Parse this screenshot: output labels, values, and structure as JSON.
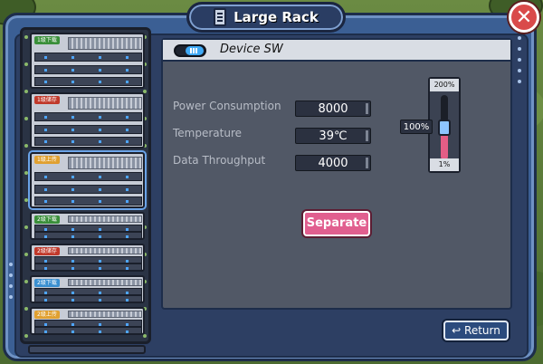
{
  "window": {
    "title": "Large Rack",
    "close_label": "✕"
  },
  "rack": {
    "units": [
      {
        "tag": "1级下载",
        "tag_color": "#3a8f3a",
        "size": "big",
        "selected": false
      },
      {
        "tag": "1级储存",
        "tag_color": "#c0392b",
        "size": "big",
        "selected": false
      },
      {
        "tag": "1级上传",
        "tag_color": "#e0a030",
        "size": "big",
        "selected": true
      },
      {
        "tag": "2级下载",
        "tag_color": "#3a8f3a",
        "size": "small",
        "selected": false
      },
      {
        "tag": "2级储存",
        "tag_color": "#c0392b",
        "size": "small",
        "selected": false
      },
      {
        "tag": "2级下载",
        "tag_color": "#3a8fd0",
        "size": "small",
        "selected": false
      },
      {
        "tag": "2级上传",
        "tag_color": "#e0a030",
        "size": "small",
        "selected": false
      }
    ]
  },
  "device": {
    "name": "Device SW",
    "stats": [
      {
        "label": "Power Consumption",
        "value": "8000"
      },
      {
        "label": "Temperature",
        "value": "39℃"
      },
      {
        "label": "Data Throughput",
        "value": "4000"
      }
    ],
    "gauge": {
      "max_label": "200%",
      "min_label": "1%",
      "current_label": "100%",
      "level": 0.5
    },
    "separate_label": "Separate"
  },
  "footer": {
    "return_label": "Return",
    "return_icon": "↩"
  },
  "colors": {
    "accent": "#3fa9f5",
    "separate": "#e15f8f",
    "gauge_fill": "#e35d86"
  }
}
